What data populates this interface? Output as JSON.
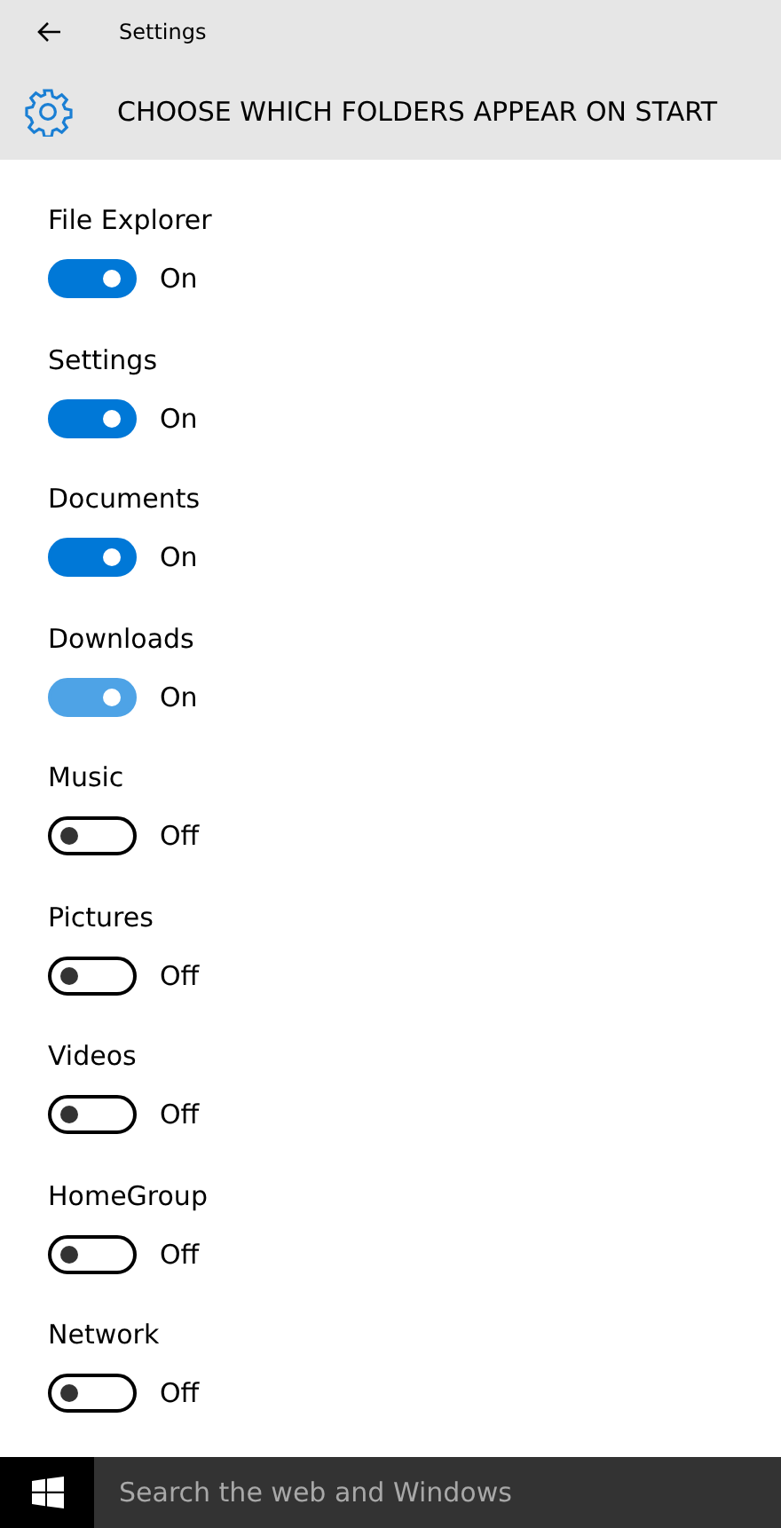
{
  "window": {
    "title": "Settings"
  },
  "header": {
    "title": "CHOOSE WHICH FOLDERS APPEAR ON START"
  },
  "folders": [
    {
      "name": "File Explorer",
      "on": true,
      "hovered": false,
      "state_label": "On"
    },
    {
      "name": "Settings",
      "on": true,
      "hovered": false,
      "state_label": "On"
    },
    {
      "name": "Documents",
      "on": true,
      "hovered": false,
      "state_label": "On"
    },
    {
      "name": "Downloads",
      "on": true,
      "hovered": true,
      "state_label": "On"
    },
    {
      "name": "Music",
      "on": false,
      "hovered": false,
      "state_label": "Off"
    },
    {
      "name": "Pictures",
      "on": false,
      "hovered": false,
      "state_label": "Off"
    },
    {
      "name": "Videos",
      "on": false,
      "hovered": false,
      "state_label": "Off"
    },
    {
      "name": "HomeGroup",
      "on": false,
      "hovered": false,
      "state_label": "Off"
    },
    {
      "name": "Network",
      "on": false,
      "hovered": false,
      "state_label": "Off"
    }
  ],
  "taskbar": {
    "search_placeholder": "Search the web and Windows"
  }
}
